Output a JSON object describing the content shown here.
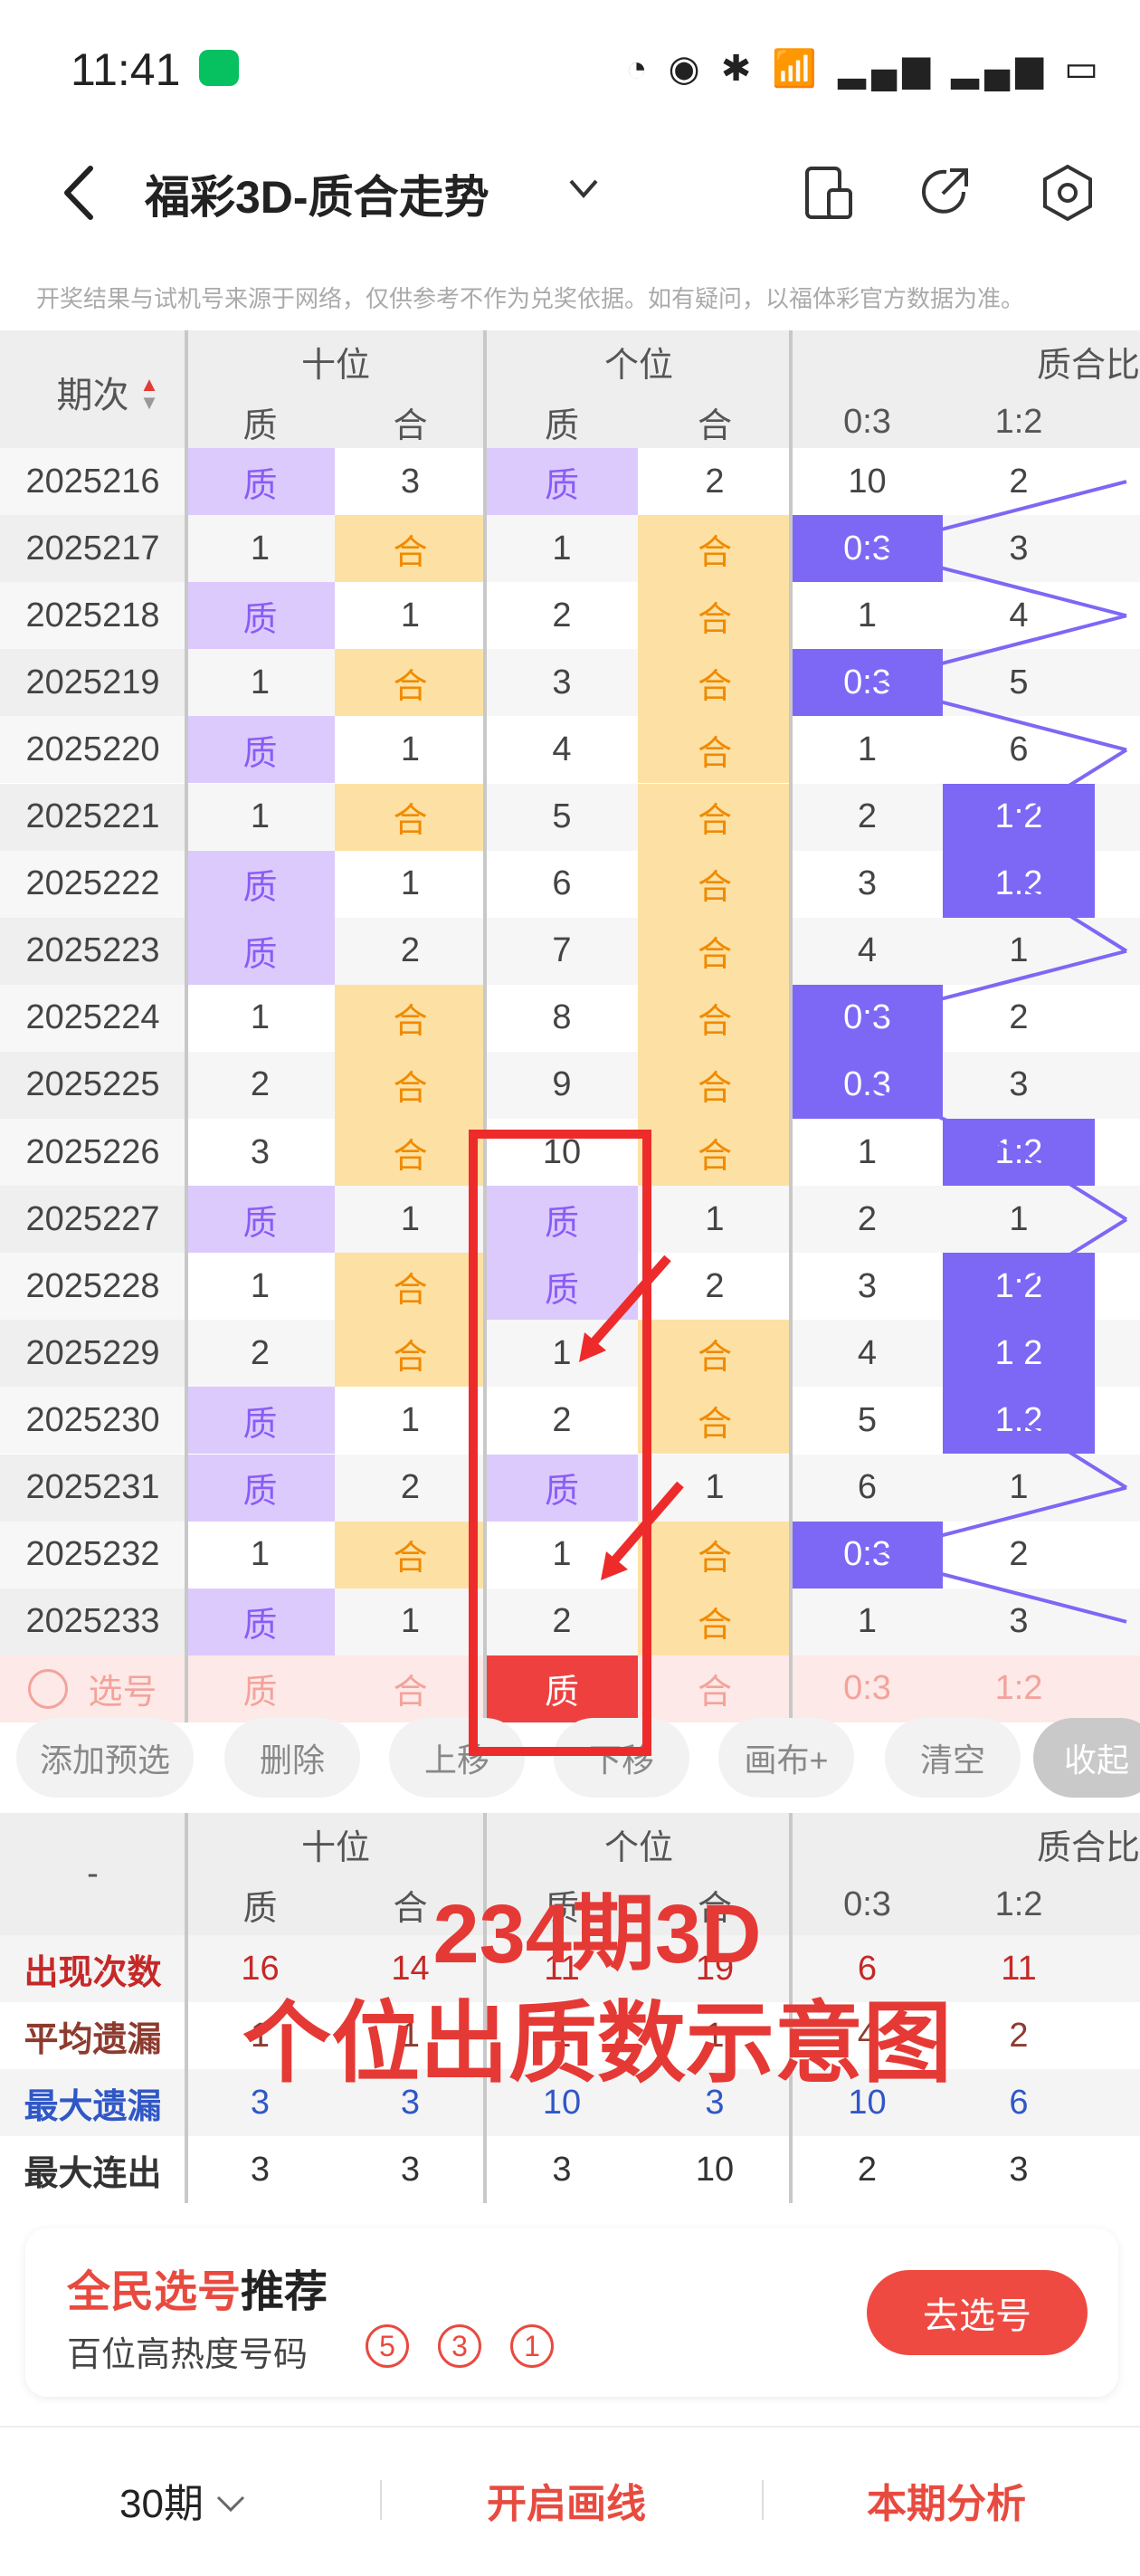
{
  "status": {
    "time": "11:41",
    "icons": "◔ ◉ ✱ 📶 ▂▄▆ ▂▄▆ ▭"
  },
  "header": {
    "title": "福彩3D-质合走势"
  },
  "disclaimer": "开奖结果与试机号来源于网络，仅供参考不作为兑奖依据。如有疑问，以福体彩官方数据为准。",
  "table": {
    "issue_header": "期次",
    "groups": [
      "十位",
      "个位",
      "质合比"
    ],
    "subcols": [
      "质",
      "合",
      "质",
      "合",
      "0:3",
      "1:2"
    ],
    "rows": [
      {
        "issue": "2025216",
        "c": [
          "质",
          "3",
          "质",
          "2",
          "10",
          "2"
        ]
      },
      {
        "issue": "2025217",
        "c": [
          "1",
          "合",
          "1",
          "合",
          "0:3",
          "3"
        ]
      },
      {
        "issue": "2025218",
        "c": [
          "质",
          "1",
          "2",
          "合",
          "1",
          "4"
        ]
      },
      {
        "issue": "2025219",
        "c": [
          "1",
          "合",
          "3",
          "合",
          "0:3",
          "5"
        ]
      },
      {
        "issue": "2025220",
        "c": [
          "质",
          "1",
          "4",
          "合",
          "1",
          "6"
        ]
      },
      {
        "issue": "2025221",
        "c": [
          "1",
          "合",
          "5",
          "合",
          "2",
          "1:2"
        ]
      },
      {
        "issue": "2025222",
        "c": [
          "质",
          "1",
          "6",
          "合",
          "3",
          "1:2"
        ]
      },
      {
        "issue": "2025223",
        "c": [
          "质",
          "2",
          "7",
          "合",
          "4",
          "1"
        ]
      },
      {
        "issue": "2025224",
        "c": [
          "1",
          "合",
          "8",
          "合",
          "0:3",
          "2"
        ]
      },
      {
        "issue": "2025225",
        "c": [
          "2",
          "合",
          "9",
          "合",
          "0:3",
          "3"
        ]
      },
      {
        "issue": "2025226",
        "c": [
          "3",
          "合",
          "10",
          "合",
          "1",
          "1:2"
        ]
      },
      {
        "issue": "2025227",
        "c": [
          "质",
          "1",
          "质",
          "1",
          "2",
          "1"
        ]
      },
      {
        "issue": "2025228",
        "c": [
          "1",
          "合",
          "质",
          "2",
          "3",
          "1:2"
        ]
      },
      {
        "issue": "2025229",
        "c": [
          "2",
          "合",
          "1",
          "合",
          "4",
          "1:2"
        ]
      },
      {
        "issue": "2025230",
        "c": [
          "质",
          "1",
          "2",
          "合",
          "5",
          "1:2"
        ]
      },
      {
        "issue": "2025231",
        "c": [
          "质",
          "2",
          "质",
          "1",
          "6",
          "1"
        ]
      },
      {
        "issue": "2025232",
        "c": [
          "1",
          "合",
          "1",
          "合",
          "0:3",
          "2"
        ]
      },
      {
        "issue": "2025233",
        "c": [
          "质",
          "1",
          "2",
          "合",
          "1",
          "3"
        ]
      }
    ],
    "select_row": {
      "label": "选号",
      "c": [
        "质",
        "合",
        "质",
        "合",
        "0:3",
        "1:2"
      ]
    }
  },
  "buttons": [
    "添加预选",
    "删除",
    "上移",
    "下移",
    "画布+",
    "清空",
    "收起"
  ],
  "stats": {
    "header_dash": "-",
    "groups": [
      "十位",
      "个位",
      "质合比"
    ],
    "subcols": [
      "质",
      "合",
      "质",
      "合",
      "0:3",
      "1:2"
    ],
    "rows": [
      {
        "label": "出现次数",
        "color": "#c62828",
        "vals": [
          "16",
          "14",
          "11",
          "19",
          "6",
          "11"
        ]
      },
      {
        "label": "平均遗漏",
        "color": "#8d3b2f",
        "vals": [
          "1",
          "1",
          "1",
          "1",
          "4",
          "2"
        ]
      },
      {
        "label": "最大遗漏",
        "color": "#3057c7",
        "vals": [
          "3",
          "3",
          "10",
          "3",
          "10",
          "6"
        ]
      },
      {
        "label": "最大连出",
        "color": "#333333",
        "vals": [
          "3",
          "3",
          "3",
          "10",
          "2",
          "3"
        ]
      }
    ]
  },
  "overlay": {
    "line1": "234期3D",
    "line2": "个位出质数示意图"
  },
  "recommend": {
    "title_red": "全民选号",
    "title_black": "推荐",
    "subtitle": "百位高热度号码",
    "balls": [
      "5",
      "3",
      "1"
    ],
    "button": "去选号"
  },
  "bottom": {
    "period": "30期",
    "draw": "开启画线",
    "analysis": "本期分析"
  },
  "colors": {
    "accent": "#e84a3f",
    "purple": "#7c68f5",
    "zhi_bg": "#dccafc",
    "he_bg": "#fde1a4"
  }
}
